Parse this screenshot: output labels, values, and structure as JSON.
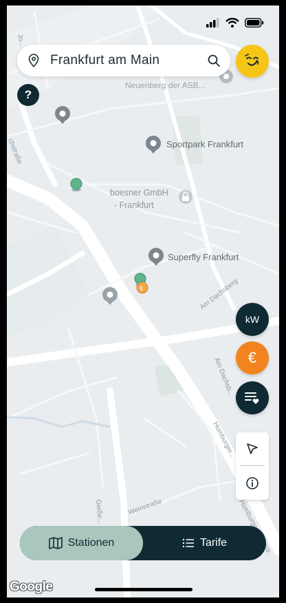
{
  "search": {
    "location": "Frankfurt am Main"
  },
  "help": {
    "label": "?"
  },
  "map": {
    "places": [
      {
        "label": "Neuenberg der ASB..."
      },
      {
        "label": "Sportpark Frankfurt"
      },
      {
        "label": "boesner GmbH"
      },
      {
        "label": "- Frankfurt"
      },
      {
        "label": "Superfly Frankfurt"
      }
    ],
    "streets": [
      {
        "label": "chstraße"
      },
      {
        "label": "Am Dachsberg"
      },
      {
        "label": "Am Dachsb..."
      },
      {
        "label": "Homburger..."
      },
      {
        "label": "Weinstraße"
      },
      {
        "label": "Gieße..."
      },
      {
        "label": "Homburger Landstr."
      },
      {
        "label": "Jo..."
      }
    ],
    "credit": "Google"
  },
  "filters": {
    "kw_label": "kW",
    "price_label": "€"
  },
  "nav": {
    "stations_label": "Stationen",
    "tariffs_label": "Tarife"
  },
  "colors": {
    "dark": "#0f2a33",
    "accent_orange": "#f2841f",
    "avatar_yellow": "#f5c518",
    "station_green": "#5fb58a",
    "toggle_active": "#a9c7bc",
    "map_bg": "#e9edf0"
  },
  "icons": [
    "location-pin-icon",
    "search-icon",
    "user-avatar-icon",
    "filter-favorites-icon",
    "navigate-arrow-icon",
    "info-icon",
    "map-icon",
    "list-icon",
    "signal-icon",
    "wifi-icon",
    "battery-icon"
  ]
}
